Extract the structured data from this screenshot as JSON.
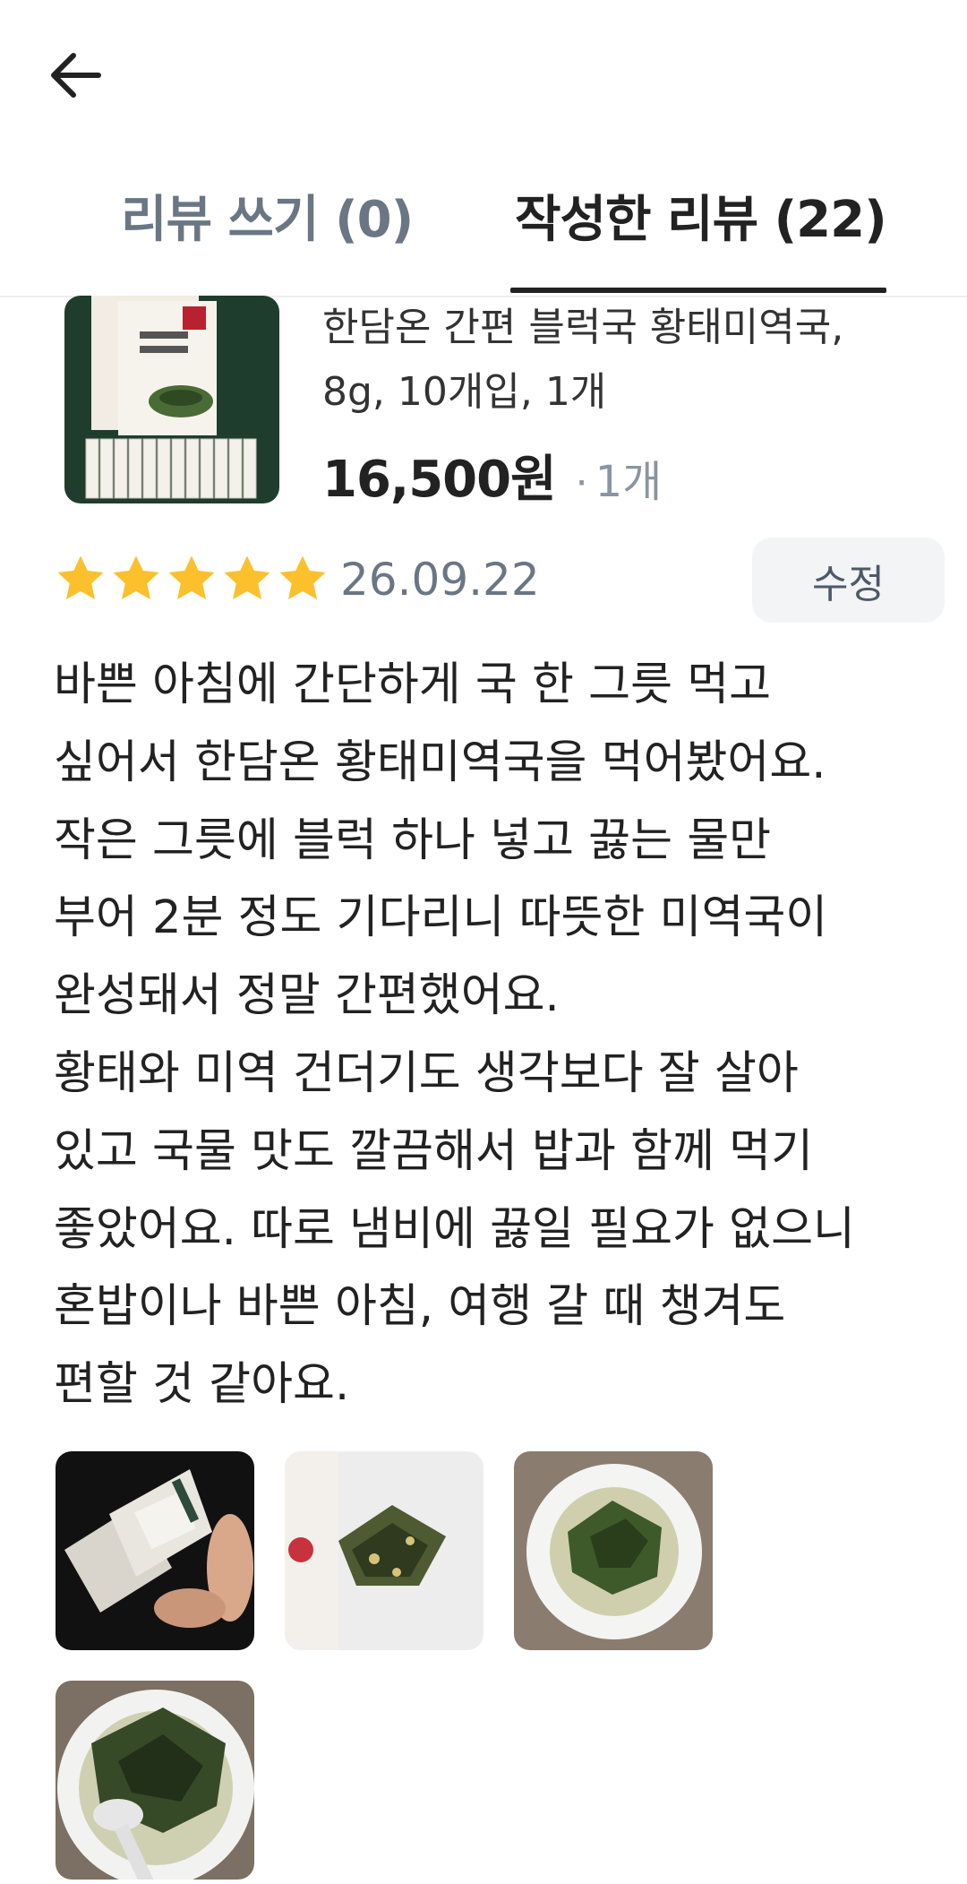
{
  "header": {
    "back_icon": "arrow-left-icon"
  },
  "tabs": [
    {
      "label": "리뷰 쓰기 (0)",
      "active": false
    },
    {
      "label": "작성한 리뷰 (22)",
      "active": true
    }
  ],
  "product": {
    "name_line1": "한담온 간편 블럭국 황태미역국,",
    "name_line2": "8g, 10개입, 1개",
    "price": "16,500원",
    "separator": "·",
    "quantity": "1개"
  },
  "review": {
    "rating": 5,
    "rating_max": 5,
    "date": "26.09.22",
    "edit_label": "수정",
    "lines": [
      "바쁜 아침에 간단하게 국 한 그릇 먹고",
      "싶어서 한담온 황태미역국을 먹어봤어요.",
      "작은 그릇에 블럭 하나 넣고 끓는 물만",
      "부어 2분 정도 기다리니 따뜻한 미역국이",
      "완성돼서 정말 간편했어요.",
      "황태와 미역 건더기도 생각보다 잘 살아",
      "있고 국물 맛도 깔끔해서 밥과 함께 먹기",
      "좋았어요. 따로 냄비에 끓일 필요가 없으니",
      "혼밥이나 바쁜 아침, 여행 갈 때 챙겨도",
      "편할 것 같아요."
    ],
    "photo_count": 4
  },
  "colors": {
    "star": "#fcc02d",
    "tab_inactive": "#6b7684",
    "text": "#222222",
    "muted": "#8b95a1",
    "edit_bg": "#f2f4f6"
  }
}
